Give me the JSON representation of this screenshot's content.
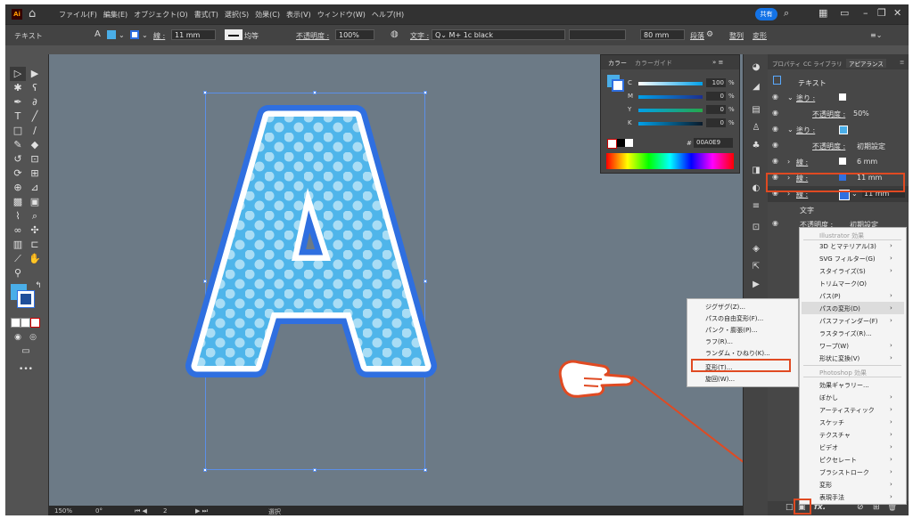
{
  "menubar": {
    "app_icon": "Ai",
    "menus": [
      "ファイル(F)",
      "編集(E)",
      "オブジェクト(O)",
      "書式(T)",
      "選択(S)",
      "効果(C)",
      "表示(V)",
      "ウィンドウ(W)",
      "ヘルプ(H)"
    ],
    "share_label": "共有"
  },
  "control": {
    "mode": "テキスト",
    "stroke_label": "線 :",
    "stroke_value": "11 mm",
    "uniform": "均等",
    "opacity_label": "不透明度 :",
    "opacity_value": "100%",
    "char_label": "文字 :",
    "font_name": "M+ 1c black",
    "size_value": "80 mm",
    "para_label": "段落",
    "align_label": "整列",
    "transform_label": "変形"
  },
  "color_panel": {
    "tabs": [
      "カラー",
      "カラーガイド"
    ],
    "channels": [
      {
        "label": "C",
        "value": "100"
      },
      {
        "label": "M",
        "value": "0"
      },
      {
        "label": "Y",
        "value": "0"
      },
      {
        "label": "K",
        "value": "0"
      }
    ],
    "pct": "%",
    "hex_prefix": "#",
    "hex": "00A0E9"
  },
  "appearance": {
    "tabs": [
      "プロパティ",
      "CC ライブラリ",
      "アピアランス"
    ],
    "title": "テキスト",
    "rows": [
      {
        "label": "塗り :"
      },
      {
        "label": "不透明度 :",
        "value": "50%"
      },
      {
        "label": "塗り :"
      },
      {
        "label": "不透明度 :",
        "value": "初期設定"
      },
      {
        "label": "線 :",
        "value": "6 mm"
      },
      {
        "label": "線 :",
        "value": "11 mm"
      },
      {
        "label": "線 :",
        "value": "11 mm"
      },
      {
        "label": "文字"
      },
      {
        "label": "不透明度 :",
        "value": "初期設定"
      }
    ]
  },
  "distort_submenu": [
    "ジグザグ(Z)...",
    "パスの自由変形(F)...",
    "パンク・膨張(P)...",
    "ラフ(R)...",
    "ランダム・ひねり(K)...",
    "変形(T)...",
    "旋回(W)..."
  ],
  "fx_menu": {
    "illustrator_header": "Illustrator 効果",
    "illustrator_items": [
      "3D とマテリアル(3)",
      "SVG フィルター(G)",
      "スタイライズ(S)",
      "トリムマーク(O)",
      "パス(P)",
      "パスの変形(D)",
      "パスファインダー(F)",
      "ラスタライズ(R)...",
      "ワープ(W)",
      "形状に変換(V)"
    ],
    "photoshop_header": "Photoshop 効果",
    "photoshop_items": [
      "効果ギャラリー...",
      "ぼかし",
      "アーティスティック",
      "スケッチ",
      "テクスチャ",
      "ビデオ",
      "ピクセレート",
      "ブラシストローク",
      "変形",
      "表現手法"
    ]
  },
  "fx_button": "fx.",
  "status": {
    "zoom": "150%",
    "angle": "0°",
    "artboard": "2",
    "mode": "選択"
  },
  "colors": {
    "accent_blue": "#00A0E9",
    "stroke_blue": "#2f6fe0",
    "highlight": "#e04a22",
    "canvas": "#6c7a86"
  }
}
